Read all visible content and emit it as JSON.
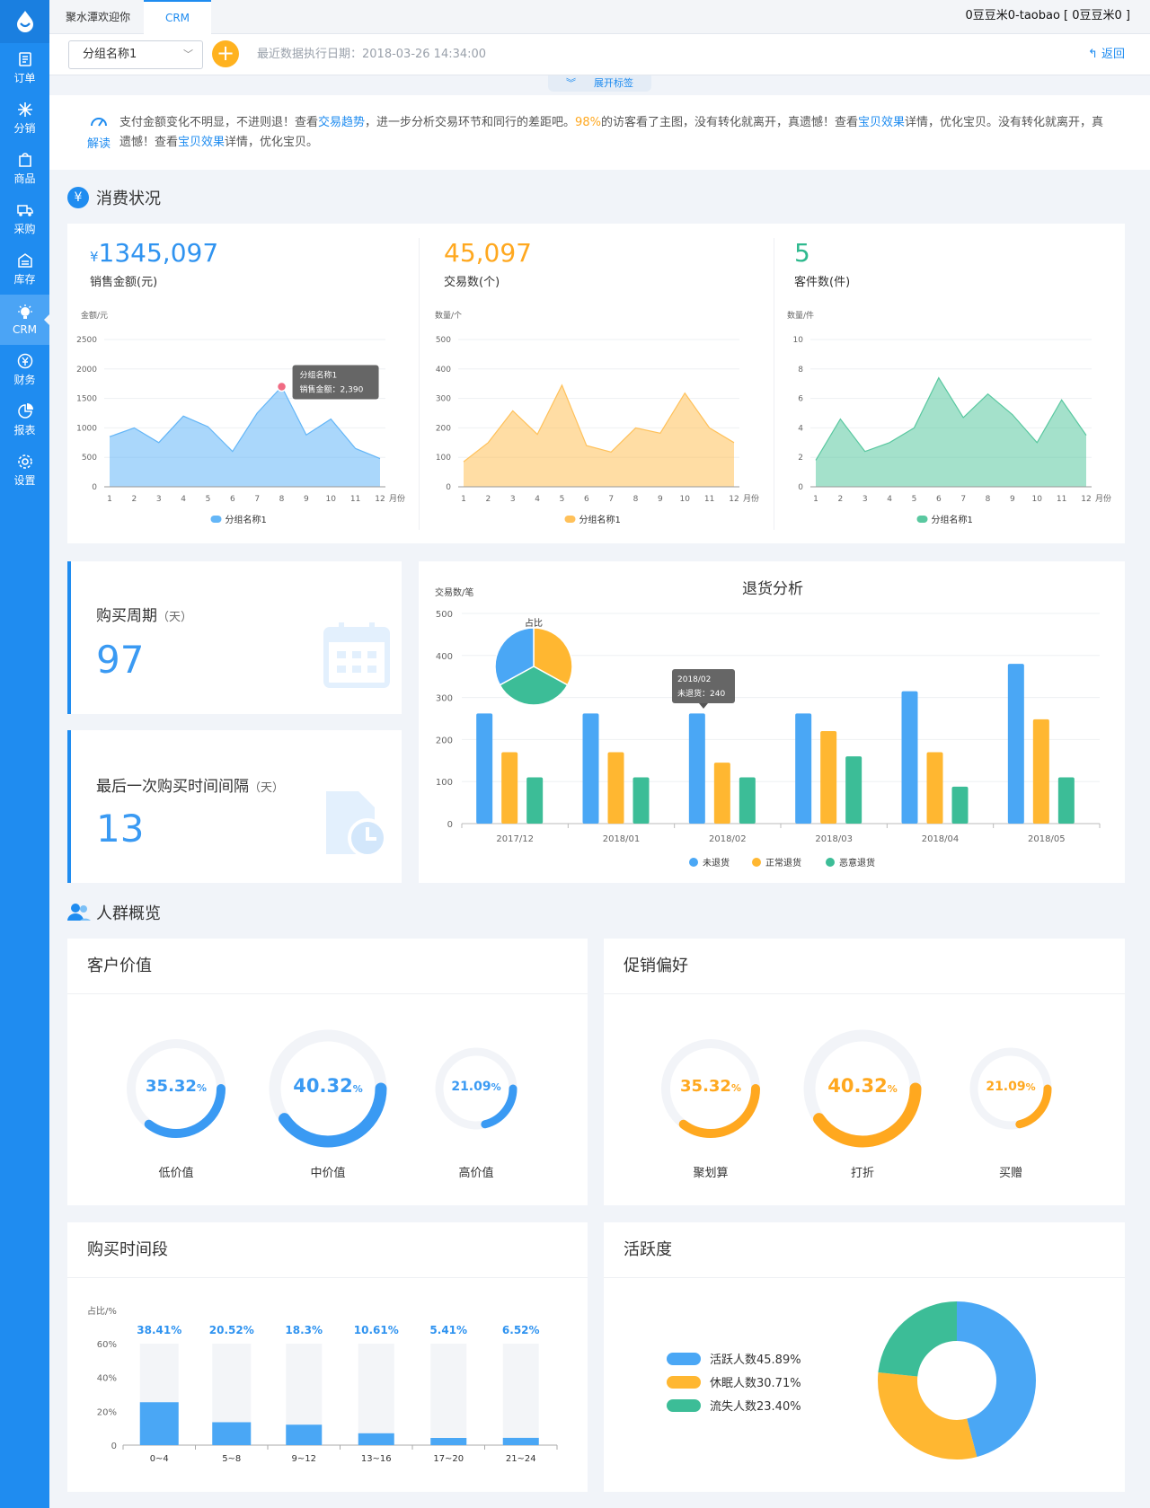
{
  "sidebar": {
    "items": [
      {
        "label": "订单",
        "icon": "order-icon"
      },
      {
        "label": "分销",
        "icon": "distribution-icon"
      },
      {
        "label": "商品",
        "icon": "goods-icon"
      },
      {
        "label": "采购",
        "icon": "purchase-icon"
      },
      {
        "label": "库存",
        "icon": "inventory-icon"
      },
      {
        "label": "CRM",
        "icon": "crm-bulb-icon",
        "active": true
      },
      {
        "label": "财务",
        "icon": "finance-icon"
      },
      {
        "label": "报表",
        "icon": "report-icon"
      },
      {
        "label": "设置",
        "icon": "settings-icon"
      }
    ]
  },
  "header": {
    "tabs": [
      "聚水潭欢迎你",
      "CRM"
    ],
    "active_tab": "CRM",
    "user": "0豆豆米0-taobao [ 0豆豆米0 ]"
  },
  "toolbar": {
    "group_select": "分组名称1",
    "exec_date": "最近数据执行日期：2018-03-26 14:34:00",
    "back_label": "返回"
  },
  "expand_label": "展开标签",
  "insight": {
    "icon_label": "解读",
    "p1": "支付金额变化不明显，不进则退！查看",
    "l1": "交易趋势",
    "p2": "，进一步分析交易环节和同行的差距吧。",
    "pct": "98%",
    "p3": "的访客看了主图，没有转化就离开，真遗憾！查看",
    "l2": "宝贝效果",
    "p4": "详情，优化宝贝。没有转化就离开，真遗憾！查看",
    "l3": "宝贝效果",
    "p5": "详情，优化宝贝。"
  },
  "consumption": {
    "title": "消费状况",
    "currency": "¥",
    "kpis": [
      {
        "value": "1345,097",
        "label": "销售金额(元)",
        "color": "#2f93f0"
      },
      {
        "value": "45,097",
        "label": "交易数(个)",
        "color": "#ffa81f"
      },
      {
        "value": "5",
        "label": "客件数(件)",
        "color": "#2fb98e"
      }
    ],
    "x_unit": "月份",
    "legend": "分组名称1",
    "tooltip": {
      "title": "分组名称1",
      "text": "销售金额：2,390"
    }
  },
  "chart_data": [
    {
      "type": "area",
      "ylabel": "金额/元",
      "xlabel": "月份",
      "x": [
        1,
        2,
        3,
        4,
        5,
        6,
        7,
        8,
        9,
        10,
        11,
        12
      ],
      "ylim": [
        0,
        2500
      ],
      "yticks": [
        0,
        500,
        1000,
        1500,
        2000,
        2500
      ],
      "series": [
        {
          "name": "分组名称1",
          "values": [
            850,
            1000,
            750,
            1200,
            1020,
            600,
            1250,
            1700,
            880,
            1150,
            650,
            480
          ]
        }
      ],
      "color": "#64b6f7",
      "highlight_index": 7
    },
    {
      "type": "area",
      "ylabel": "数量/个",
      "xlabel": "月份",
      "x": [
        1,
        2,
        3,
        4,
        5,
        6,
        7,
        8,
        9,
        10,
        11,
        12
      ],
      "ylim": [
        0,
        500
      ],
      "yticks": [
        0,
        100,
        200,
        300,
        400,
        500
      ],
      "series": [
        {
          "name": "分组名称1",
          "values": [
            85,
            150,
            258,
            178,
            345,
            140,
            118,
            200,
            182,
            318,
            200,
            150
          ]
        }
      ],
      "color": "#ffc15a"
    },
    {
      "type": "area",
      "ylabel": "数量/件",
      "xlabel": "月份",
      "x": [
        1,
        2,
        3,
        4,
        5,
        6,
        7,
        8,
        9,
        10,
        11,
        12
      ],
      "ylim": [
        0,
        10
      ],
      "yticks": [
        0,
        2,
        4,
        6,
        8,
        10
      ],
      "series": [
        {
          "name": "分组名称1",
          "values": [
            1.8,
            4.6,
            2.4,
            3.0,
            4.0,
            7.4,
            4.7,
            6.3,
            4.9,
            3.0,
            5.9,
            3.5
          ]
        }
      ],
      "color": "#5ac8a0"
    },
    {
      "type": "bar",
      "title": "退货分析",
      "ylabel": "交易数/笔",
      "categories": [
        "2017/12",
        "2018/01",
        "2018/02",
        "2018/03",
        "2018/04",
        "2018/05"
      ],
      "ylim": [
        0,
        500
      ],
      "yticks": [
        0,
        100,
        200,
        300,
        400,
        500
      ],
      "series": [
        {
          "name": "未退货",
          "values": [
            262,
            262,
            262,
            262,
            315,
            380
          ],
          "color": "#4aa7f5"
        },
        {
          "name": "正常退货",
          "values": [
            170,
            170,
            145,
            220,
            170,
            248
          ],
          "color": "#ffb731"
        },
        {
          "name": "恶意退货",
          "values": [
            110,
            110,
            110,
            160,
            88,
            110
          ],
          "color": "#3cbd97"
        }
      ],
      "tooltip": {
        "title": "2018/02",
        "text": "未退货：240"
      }
    },
    {
      "type": "pie",
      "title": "占比",
      "values": [
        33,
        34,
        33
      ],
      "colors": [
        "#ffb731",
        "#3cbd97",
        "#4aa7f5"
      ]
    },
    {
      "type": "bar",
      "title": "购买时间段",
      "ylabel": "占比/%",
      "categories": [
        "0~4",
        "5~8",
        "9~12",
        "13~16",
        "17~20",
        "21~24"
      ],
      "yticks": [
        "0",
        "20%",
        "40%",
        "60%"
      ],
      "values": [
        38.41,
        20.52,
        18.3,
        10.61,
        5.41,
        6.52
      ],
      "labels": [
        "38.41%",
        "20.52%",
        "18.3%",
        "10.61%",
        "5.41%",
        "6.52%"
      ]
    },
    {
      "type": "pie",
      "title": "活跃度",
      "values": [
        45.89,
        30.71,
        23.4
      ],
      "labels": [
        "活跃人数45.89%",
        "休眠人数30.71%",
        "流失人数23.40%"
      ],
      "colors": [
        "#4aa7f5",
        "#ffb731",
        "#3cbd97"
      ]
    }
  ],
  "stats": [
    {
      "label": "购买周期",
      "unit": "（天）",
      "value": "97",
      "icon": "calendar-icon"
    },
    {
      "label": "最后一次购买时间间隔",
      "unit": "（天）",
      "value": "13",
      "icon": "file-clock-icon"
    }
  ],
  "return_legend": [
    "未退货",
    "正常退货",
    "恶意退货"
  ],
  "crowd": {
    "title": "人群概览"
  },
  "customer_value": {
    "title": "客户价值",
    "items": [
      {
        "value": "35.32",
        "label": "低价值",
        "frac": 0.3532
      },
      {
        "value": "40.32",
        "label": "中价值",
        "frac": 0.4032
      },
      {
        "value": "21.09",
        "label": "高价值",
        "frac": 0.2109
      }
    ],
    "pct_unit": "%",
    "color": "#3a9af3"
  },
  "promo": {
    "title": "促销偏好",
    "items": [
      {
        "value": "35.32",
        "label": "聚划算",
        "frac": 0.3532
      },
      {
        "value": "40.32",
        "label": "打折",
        "frac": 0.4032
      },
      {
        "value": "21.09",
        "label": "买赠",
        "frac": 0.2109
      }
    ],
    "pct_unit": "%",
    "color": "#ffa81f"
  },
  "buy_time": {
    "title": "购买时间段"
  },
  "activity": {
    "title": "活跃度"
  }
}
